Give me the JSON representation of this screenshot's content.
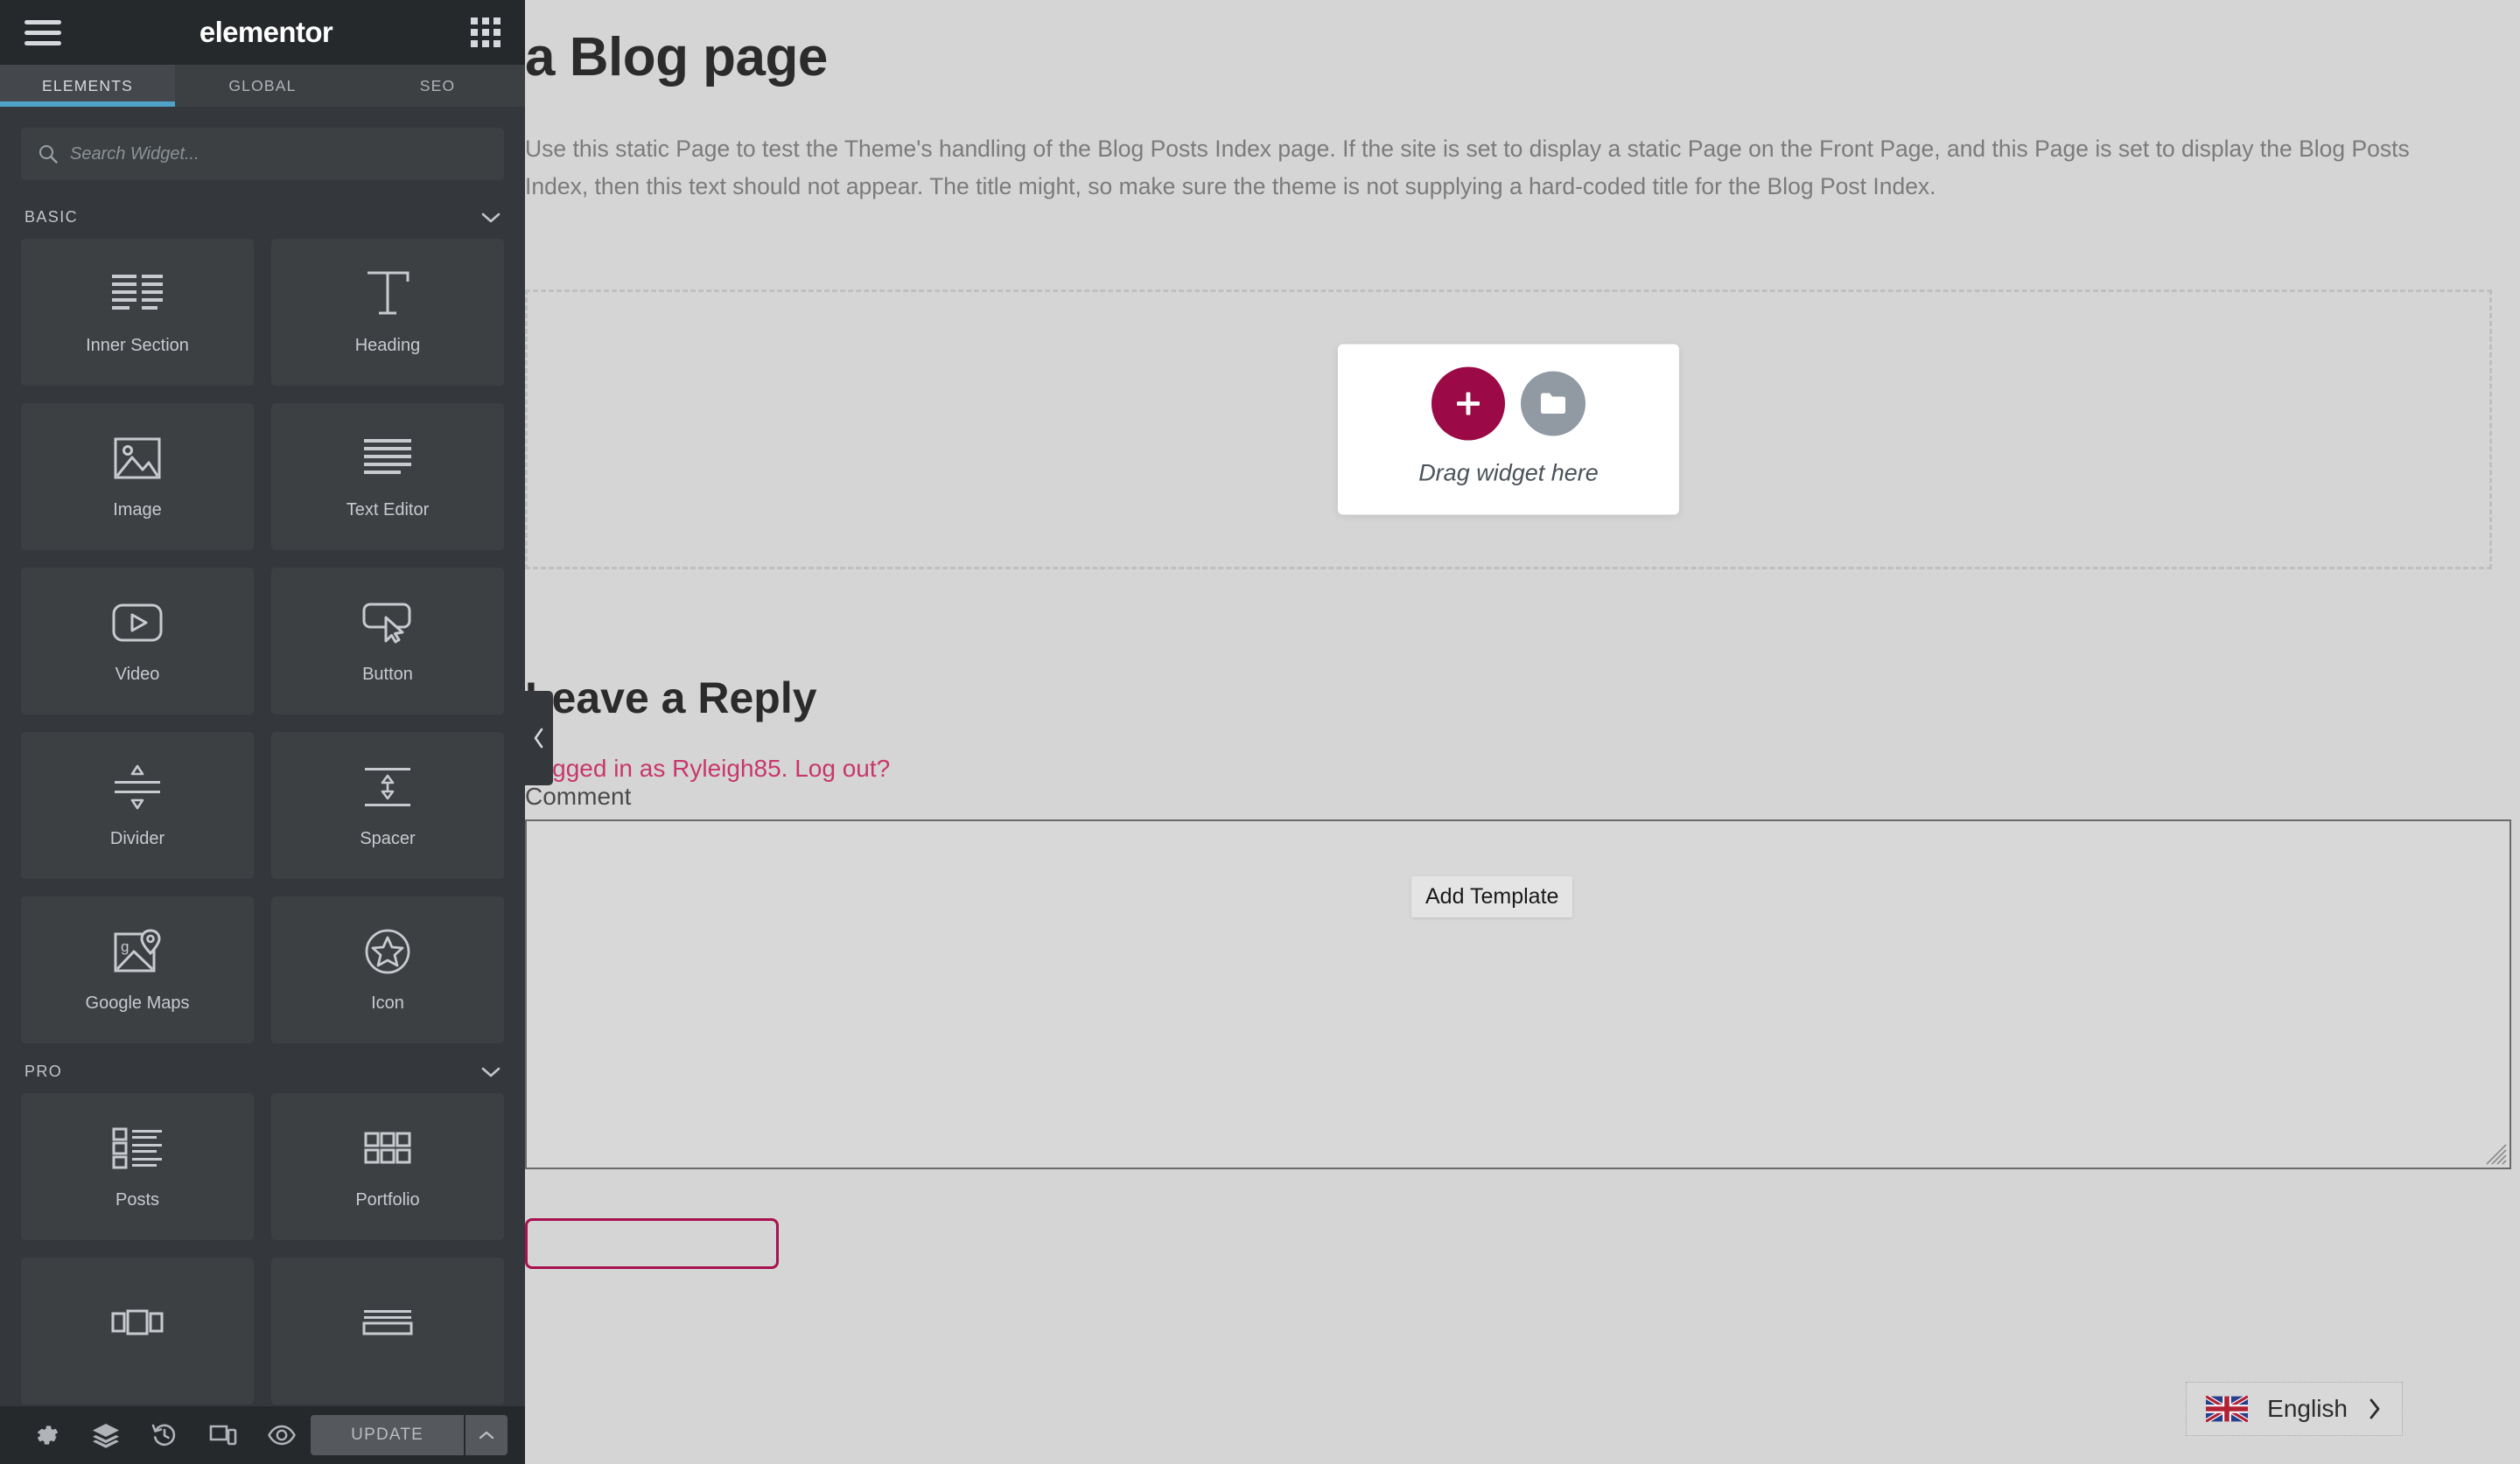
{
  "panel": {
    "logo": "elementor",
    "menu_icon": "hamburger-icon",
    "apps_icon": "widgets-grid-icon",
    "tabs": [
      {
        "label": "ELEMENTS",
        "active": true
      },
      {
        "label": "GLOBAL",
        "active": false
      },
      {
        "label": "SEO",
        "active": false
      }
    ],
    "search": {
      "placeholder": "Search Widget...",
      "value": "",
      "icon": "search-icon"
    },
    "categories": [
      {
        "name": "BASIC",
        "collapse_icon": "chevron-down-icon",
        "widgets": [
          {
            "label": "Inner Section",
            "icon": "inner-section-icon"
          },
          {
            "label": "Heading",
            "icon": "heading-icon"
          },
          {
            "label": "Image",
            "icon": "image-icon"
          },
          {
            "label": "Text Editor",
            "icon": "text-editor-icon"
          },
          {
            "label": "Video",
            "icon": "video-icon"
          },
          {
            "label": "Button",
            "icon": "button-icon"
          },
          {
            "label": "Divider",
            "icon": "divider-icon"
          },
          {
            "label": "Spacer",
            "icon": "spacer-icon"
          },
          {
            "label": "Google Maps",
            "icon": "google-maps-icon"
          },
          {
            "label": "Icon",
            "icon": "star-icon"
          }
        ]
      },
      {
        "name": "PRO",
        "collapse_icon": "chevron-down-icon",
        "widgets": [
          {
            "label": "Posts",
            "icon": "posts-icon"
          },
          {
            "label": "Portfolio",
            "icon": "portfolio-icon"
          },
          {
            "label": "",
            "icon": "slides-icon"
          },
          {
            "label": "",
            "icon": "form-icon"
          }
        ]
      }
    ],
    "footer": {
      "tools": [
        {
          "name": "settings-icon",
          "title": "Settings"
        },
        {
          "name": "navigator-layers-icon",
          "title": "Navigator"
        },
        {
          "name": "history-icon",
          "title": "History"
        },
        {
          "name": "responsive-mode-icon",
          "title": "Responsive Mode"
        },
        {
          "name": "preview-eye-icon",
          "title": "Preview Changes"
        }
      ],
      "update_label": "UPDATE",
      "update_caret_icon": "chevron-up-icon"
    },
    "collapse_icon": "chevron-left-icon"
  },
  "canvas": {
    "page_title": "a Blog page",
    "page_body": "Use this static Page to test the Theme's handling of the Blog Posts Index page. If the site is set to display a static Page on the Front Page, and this Page is set to display the Blog Posts Index, then this text should not appear. The title might, so make sure the theme is not supplying a hard-coded title for the Blog Post Index.",
    "dropzone": {
      "add_widget_icon": "plus-icon",
      "add_template_icon": "folder-icon",
      "drag_hint": "Drag widget here",
      "tooltip": "Add Template"
    },
    "comments": {
      "reply_title": "Leave a Reply",
      "logged_in_prefix": "Logged in as ",
      "username": "Ryleigh85",
      "logged_in_separator": ". ",
      "logout_label": "Log out?",
      "comment_label": "Comment",
      "comment_value": "",
      "resize_grip_icon": "resize-grip-icon"
    }
  },
  "language_switcher": {
    "label": "English",
    "flag_icon": "uk-flag-icon",
    "chevron_icon": "chevron-right-icon"
  },
  "colors": {
    "panel_bg": "#34383c",
    "panel_header_bg": "#26292c",
    "widget_bg": "#3c4043",
    "tab_accent": "#4fa3c8",
    "add_widget": "#9b0a46",
    "add_template": "#919aa3",
    "link_pink": "#c8376b",
    "submit_border": "#a8114f",
    "canvas_bg": "#d5d5d5"
  }
}
